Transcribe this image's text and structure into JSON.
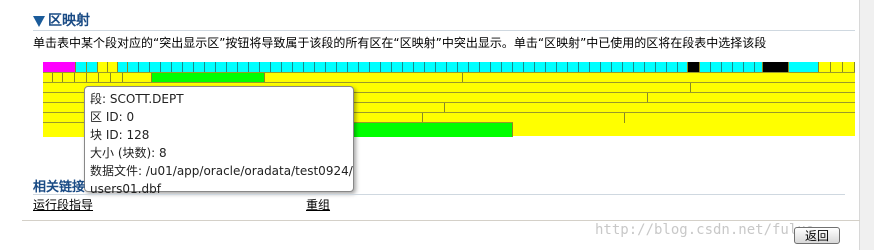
{
  "section": {
    "title": "区映射",
    "icon": "triangle-down-icon"
  },
  "description": "单击表中某个段对应的“突出显示区”按钮将导致属于该段的所有区在“区映射”中突出显示。单击“区映射”中已使用的区将在段表中选择该段",
  "extent_map": {
    "colors": {
      "free": "#ffff00",
      "selected_segment": "#00ffff",
      "highlighted": "#00ff00",
      "current": "#ff00ff",
      "other": "#000000"
    },
    "rows": 7
  },
  "tooltip": {
    "segment": "段: SCOTT.DEPT",
    "extent_id": "区 ID: 0",
    "block_id": "块 ID: 128",
    "size": "大小 (块数): 8",
    "datafile_line1": "数据文件: /u01/app/oracle/oradata/test0924/",
    "datafile_line2": "users01.dbf"
  },
  "related": {
    "title": "相关链接",
    "links": [
      "运行段指导",
      "重组"
    ]
  },
  "watermark": "http://blog.csdn.net/fuluo",
  "buttons": {
    "back": "返回"
  }
}
